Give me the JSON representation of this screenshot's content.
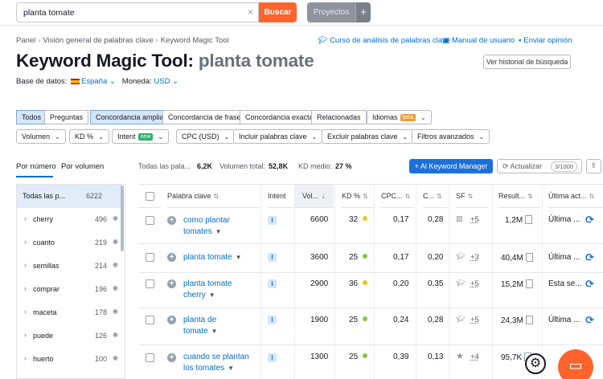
{
  "search": {
    "value": "planta tomate",
    "button": "Buscar",
    "projects": "Proyectos",
    "plus": "+",
    "clear": "×"
  },
  "breadcrumb": [
    "Panel",
    "Visión general de palabras clave",
    "Keyword Magic Tool"
  ],
  "links": {
    "course": "Curso de análisis de palabras clave",
    "manual": "Manual de usuario",
    "feedback": "Enviar opinión"
  },
  "title": {
    "tool": "Keyword Magic Tool:",
    "query": "planta tomate",
    "history_button": "Ver historial de búsqueda"
  },
  "database": {
    "label": "Base de datos:",
    "value": "España",
    "currency_label": "Moneda:",
    "currency": "USD"
  },
  "match_tabs": [
    "Todos",
    "Preguntas",
    "Concordancia amplia",
    "Concordancia de frase",
    "Concordancia exacta",
    "Relacionadas"
  ],
  "languages": {
    "label": "Idiomas",
    "badge": "beta"
  },
  "filters": {
    "volume": "Volumen",
    "kd": "KD %",
    "intent": "Intent",
    "intent_badge": "new",
    "cpc": "CPC (USD)",
    "include": "Incluir palabras clave",
    "exclude": "Excluir palabras clave",
    "advanced": "Filtros avanzados"
  },
  "view_tabs": {
    "by_number": "Por número",
    "by_volume": "Por volumen"
  },
  "stats": {
    "all_label": "Todas las pala...",
    "all_value": "6,2K",
    "volume_label": "Volumen total:",
    "volume_value": "52,8K",
    "kd_label": "KD medio:",
    "kd_value": "27 %"
  },
  "actions": {
    "keyword_manager": "Al Keyword Manager",
    "update": "Actualizar",
    "update_count": "3/1000"
  },
  "groups": [
    {
      "name": "Todas las p...",
      "count": "6222"
    },
    {
      "name": "cherry",
      "count": "496"
    },
    {
      "name": "cuanto",
      "count": "219"
    },
    {
      "name": "semillas",
      "count": "214"
    },
    {
      "name": "comprar",
      "count": "196"
    },
    {
      "name": "maceta",
      "count": "178"
    },
    {
      "name": "puede",
      "count": "126"
    },
    {
      "name": "huerto",
      "count": "100"
    }
  ],
  "table": {
    "headers": [
      "Palabra clave",
      "Intent",
      "Vol...",
      "KD %",
      "CPC...",
      "C...",
      "SF",
      "Result...",
      "Última act..."
    ],
    "rows": [
      {
        "keyword_l1": "como plantar",
        "keyword_l2": "tomates",
        "intent": "I",
        "volume": "6600",
        "kd": "32",
        "kd_color": "#f5c524",
        "cpc": "0,17",
        "com": "0,28",
        "sf": "+5",
        "results": "1,2M",
        "updated": "Última ..."
      },
      {
        "keyword_l1": "planta tomate",
        "keyword_l2": "",
        "intent": "I",
        "volume": "3600",
        "kd": "25",
        "kd_color": "#8fc43f",
        "cpc": "0,17",
        "com": "0,20",
        "sf": "+3",
        "results": "40,4M",
        "updated": "Última ..."
      },
      {
        "keyword_l1": "planta tomate",
        "keyword_l2": "cherry",
        "intent": "I",
        "volume": "2900",
        "kd": "36",
        "kd_color": "#f5c524",
        "cpc": "0,20",
        "com": "0,35",
        "sf": "+5",
        "results": "15,2M",
        "updated": "Esta se..."
      },
      {
        "keyword_l1": "planta de",
        "keyword_l2": "tomate",
        "intent": "I",
        "volume": "1900",
        "kd": "25",
        "kd_color": "#8fc43f",
        "cpc": "0,24",
        "com": "0,28",
        "sf": "+5",
        "results": "24,3M",
        "updated": "Última ..."
      },
      {
        "keyword_l1": "cuando se plantan",
        "keyword_l2": "los tomates",
        "intent": "I",
        "volume": "1300",
        "kd": "25",
        "kd_color": "#8fc43f",
        "cpc": "0,39",
        "com": "0,13",
        "sf": "+4",
        "results": "95,7K",
        "updated": "Última ..."
      }
    ]
  }
}
